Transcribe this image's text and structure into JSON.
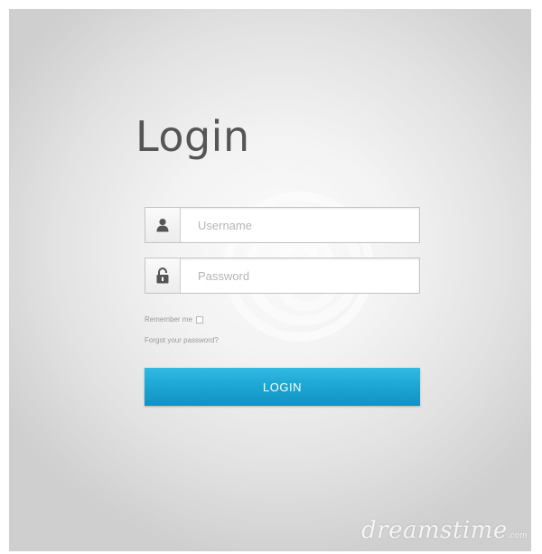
{
  "login": {
    "title": "Login",
    "username_placeholder": "Username",
    "password_placeholder": "Password",
    "remember_label": "Remember me",
    "forgot_label": "Forgot your password?",
    "button_label": "LOGIN"
  },
  "watermark": {
    "text": "dreamstime",
    "suffix": ".com"
  },
  "colors": {
    "button": "#1ba4d3",
    "title": "#555555",
    "background": "#f3f3f3"
  },
  "icons": {
    "username": "user-icon",
    "password": "lock-icon"
  }
}
